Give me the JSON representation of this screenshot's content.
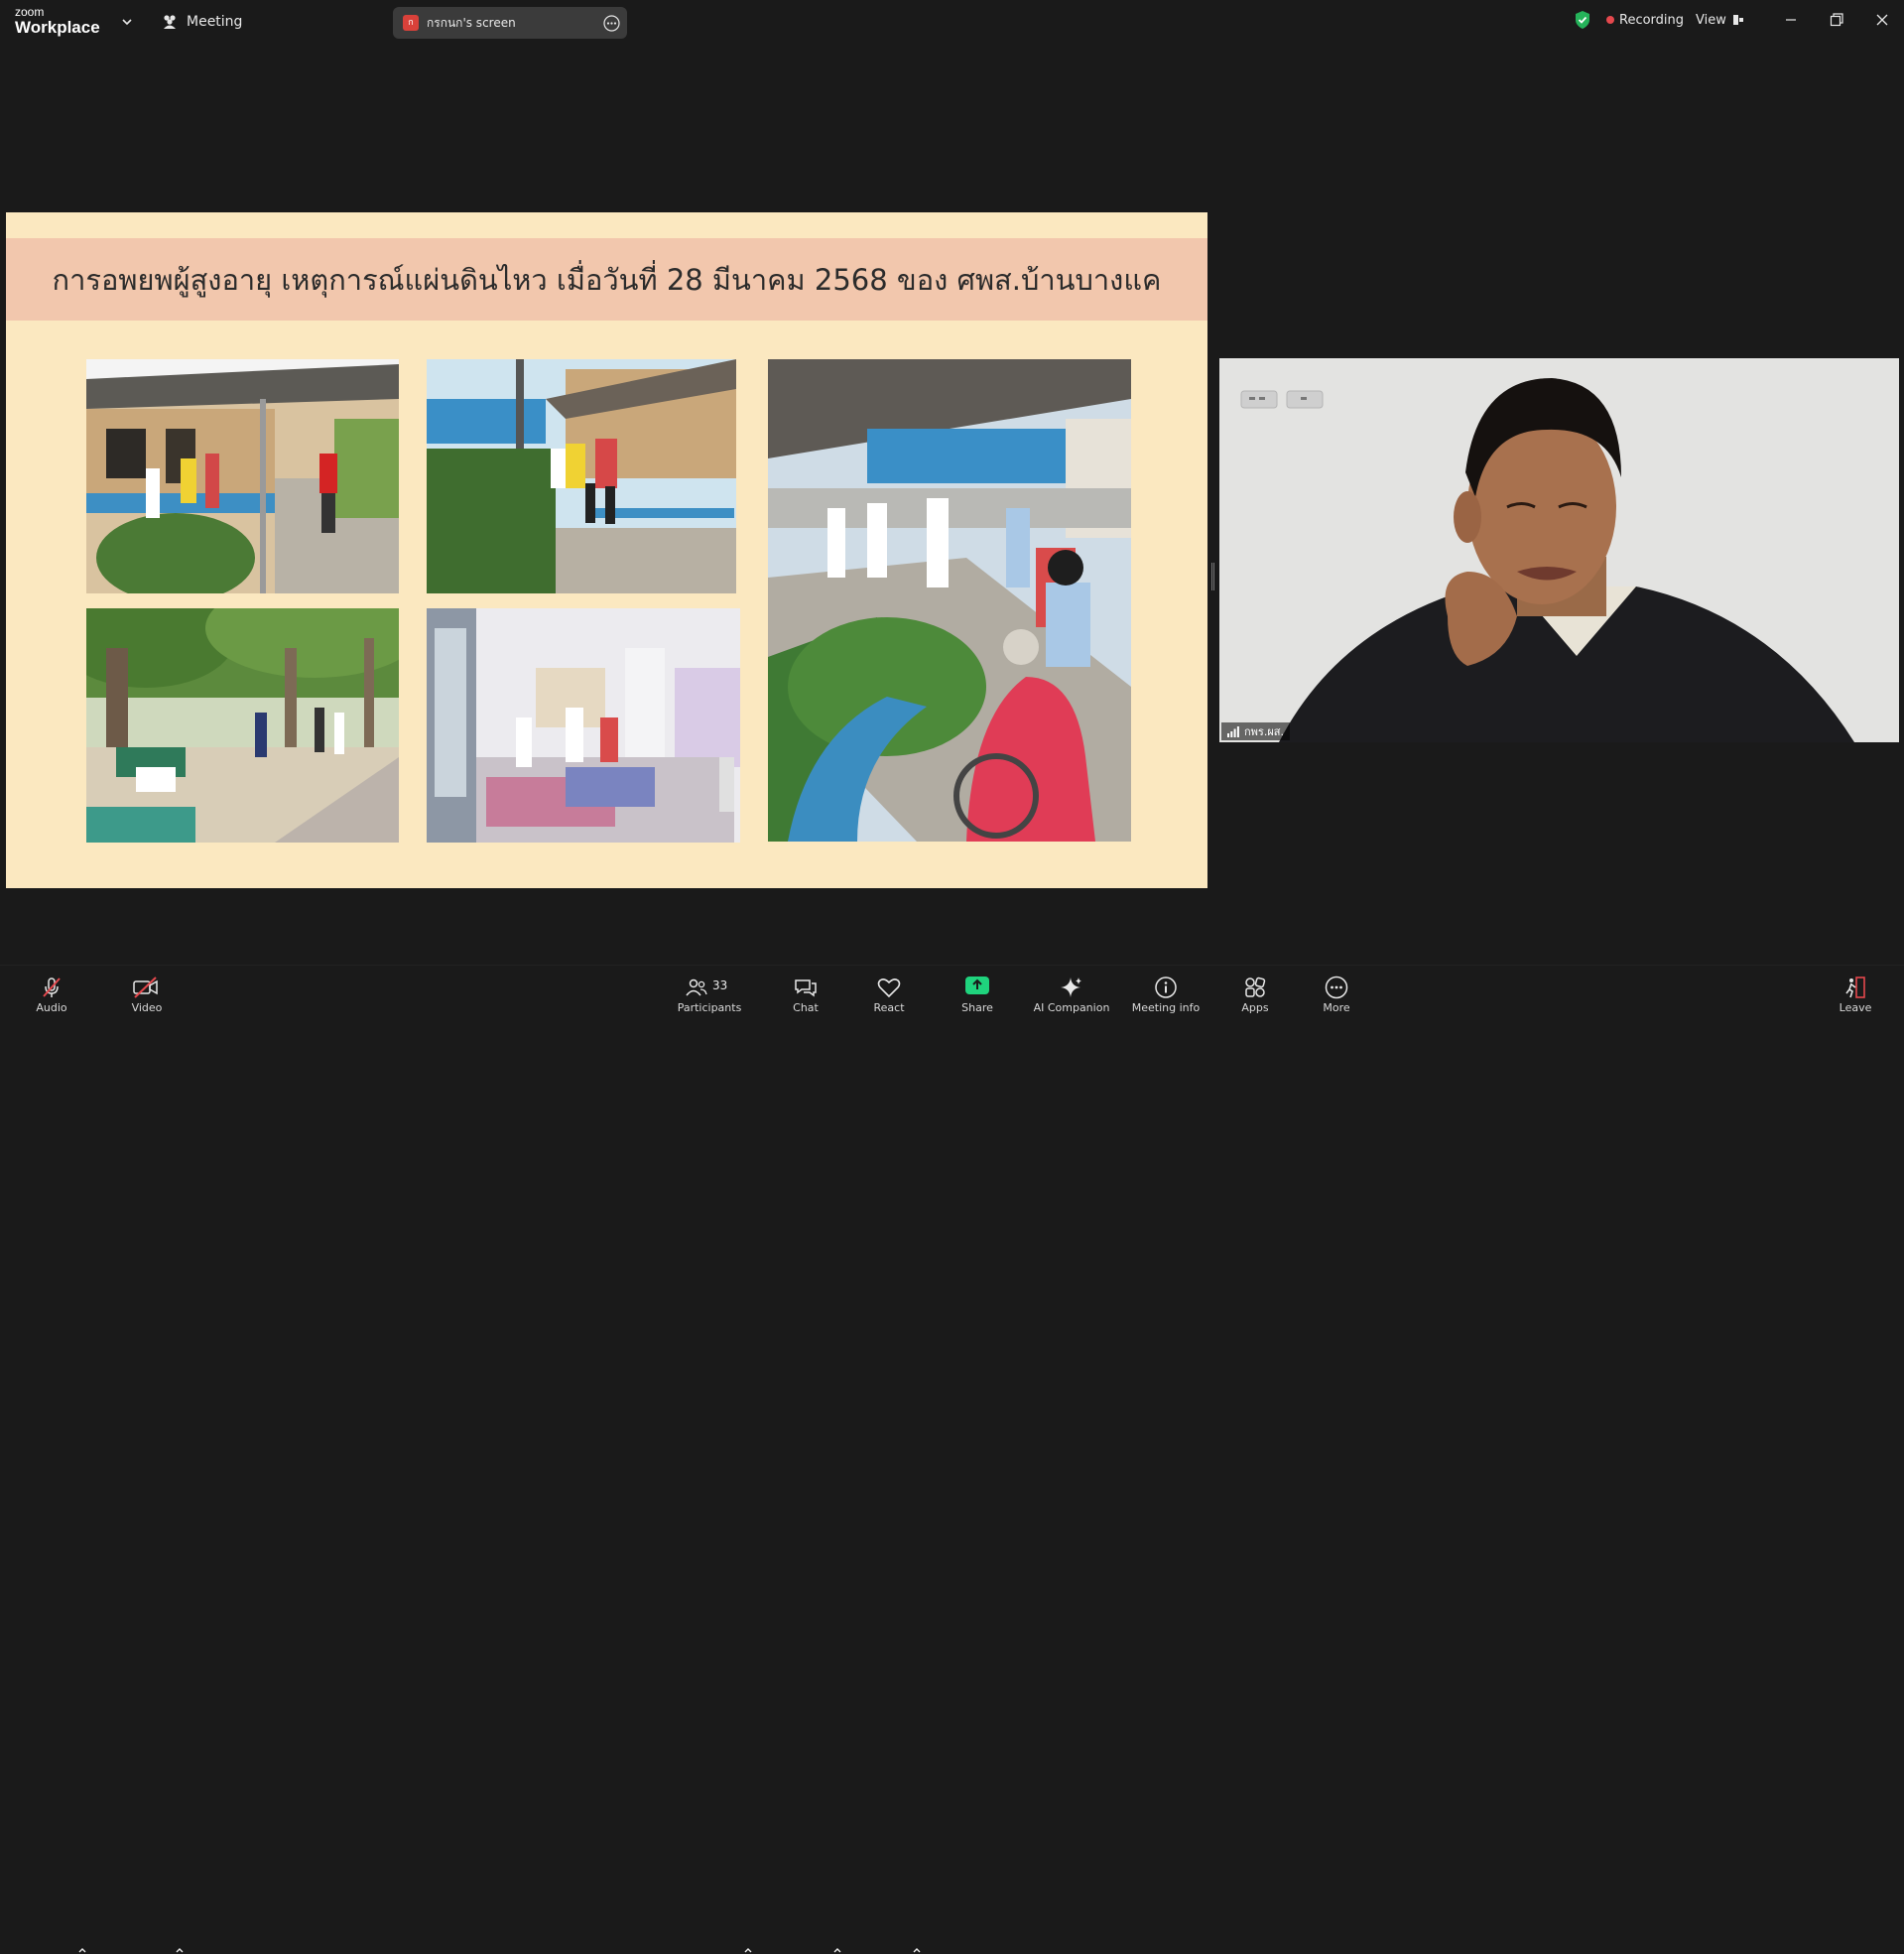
{
  "app": {
    "logo_top": "zoom",
    "logo_bottom": "Workplace"
  },
  "header": {
    "meeting_label": "Meeting",
    "share_badge": "ก",
    "share_label": "กรกนก's screen",
    "recording_label": "Recording",
    "view_label": "View"
  },
  "slide": {
    "title": "การอพยพผู้สูงอายุ เหตุการณ์แผ่นดินไหว เมื่อวันที่ 28 มีนาคม 2568 ของ ศพส.บ้านบางแค"
  },
  "video": {
    "participant_name": "กพร.ผส."
  },
  "toolbar": {
    "audio_label": "Audio",
    "video_label": "Video",
    "participants_label": "Participants",
    "participants_count": "33",
    "chat_label": "Chat",
    "react_label": "React",
    "share_label": "Share",
    "ai_label": "AI Companion",
    "info_label": "Meeting info",
    "apps_label": "Apps",
    "more_label": "More",
    "leave_label": "Leave"
  },
  "colors": {
    "background": "#1a1a1a",
    "slide_bg": "#fbe8c0",
    "slide_band": "#f2c7ad",
    "recording": "#e5484d",
    "share_green": "#1fd37d",
    "shield_green": "#25b35a",
    "leave_red": "#e5484d"
  }
}
